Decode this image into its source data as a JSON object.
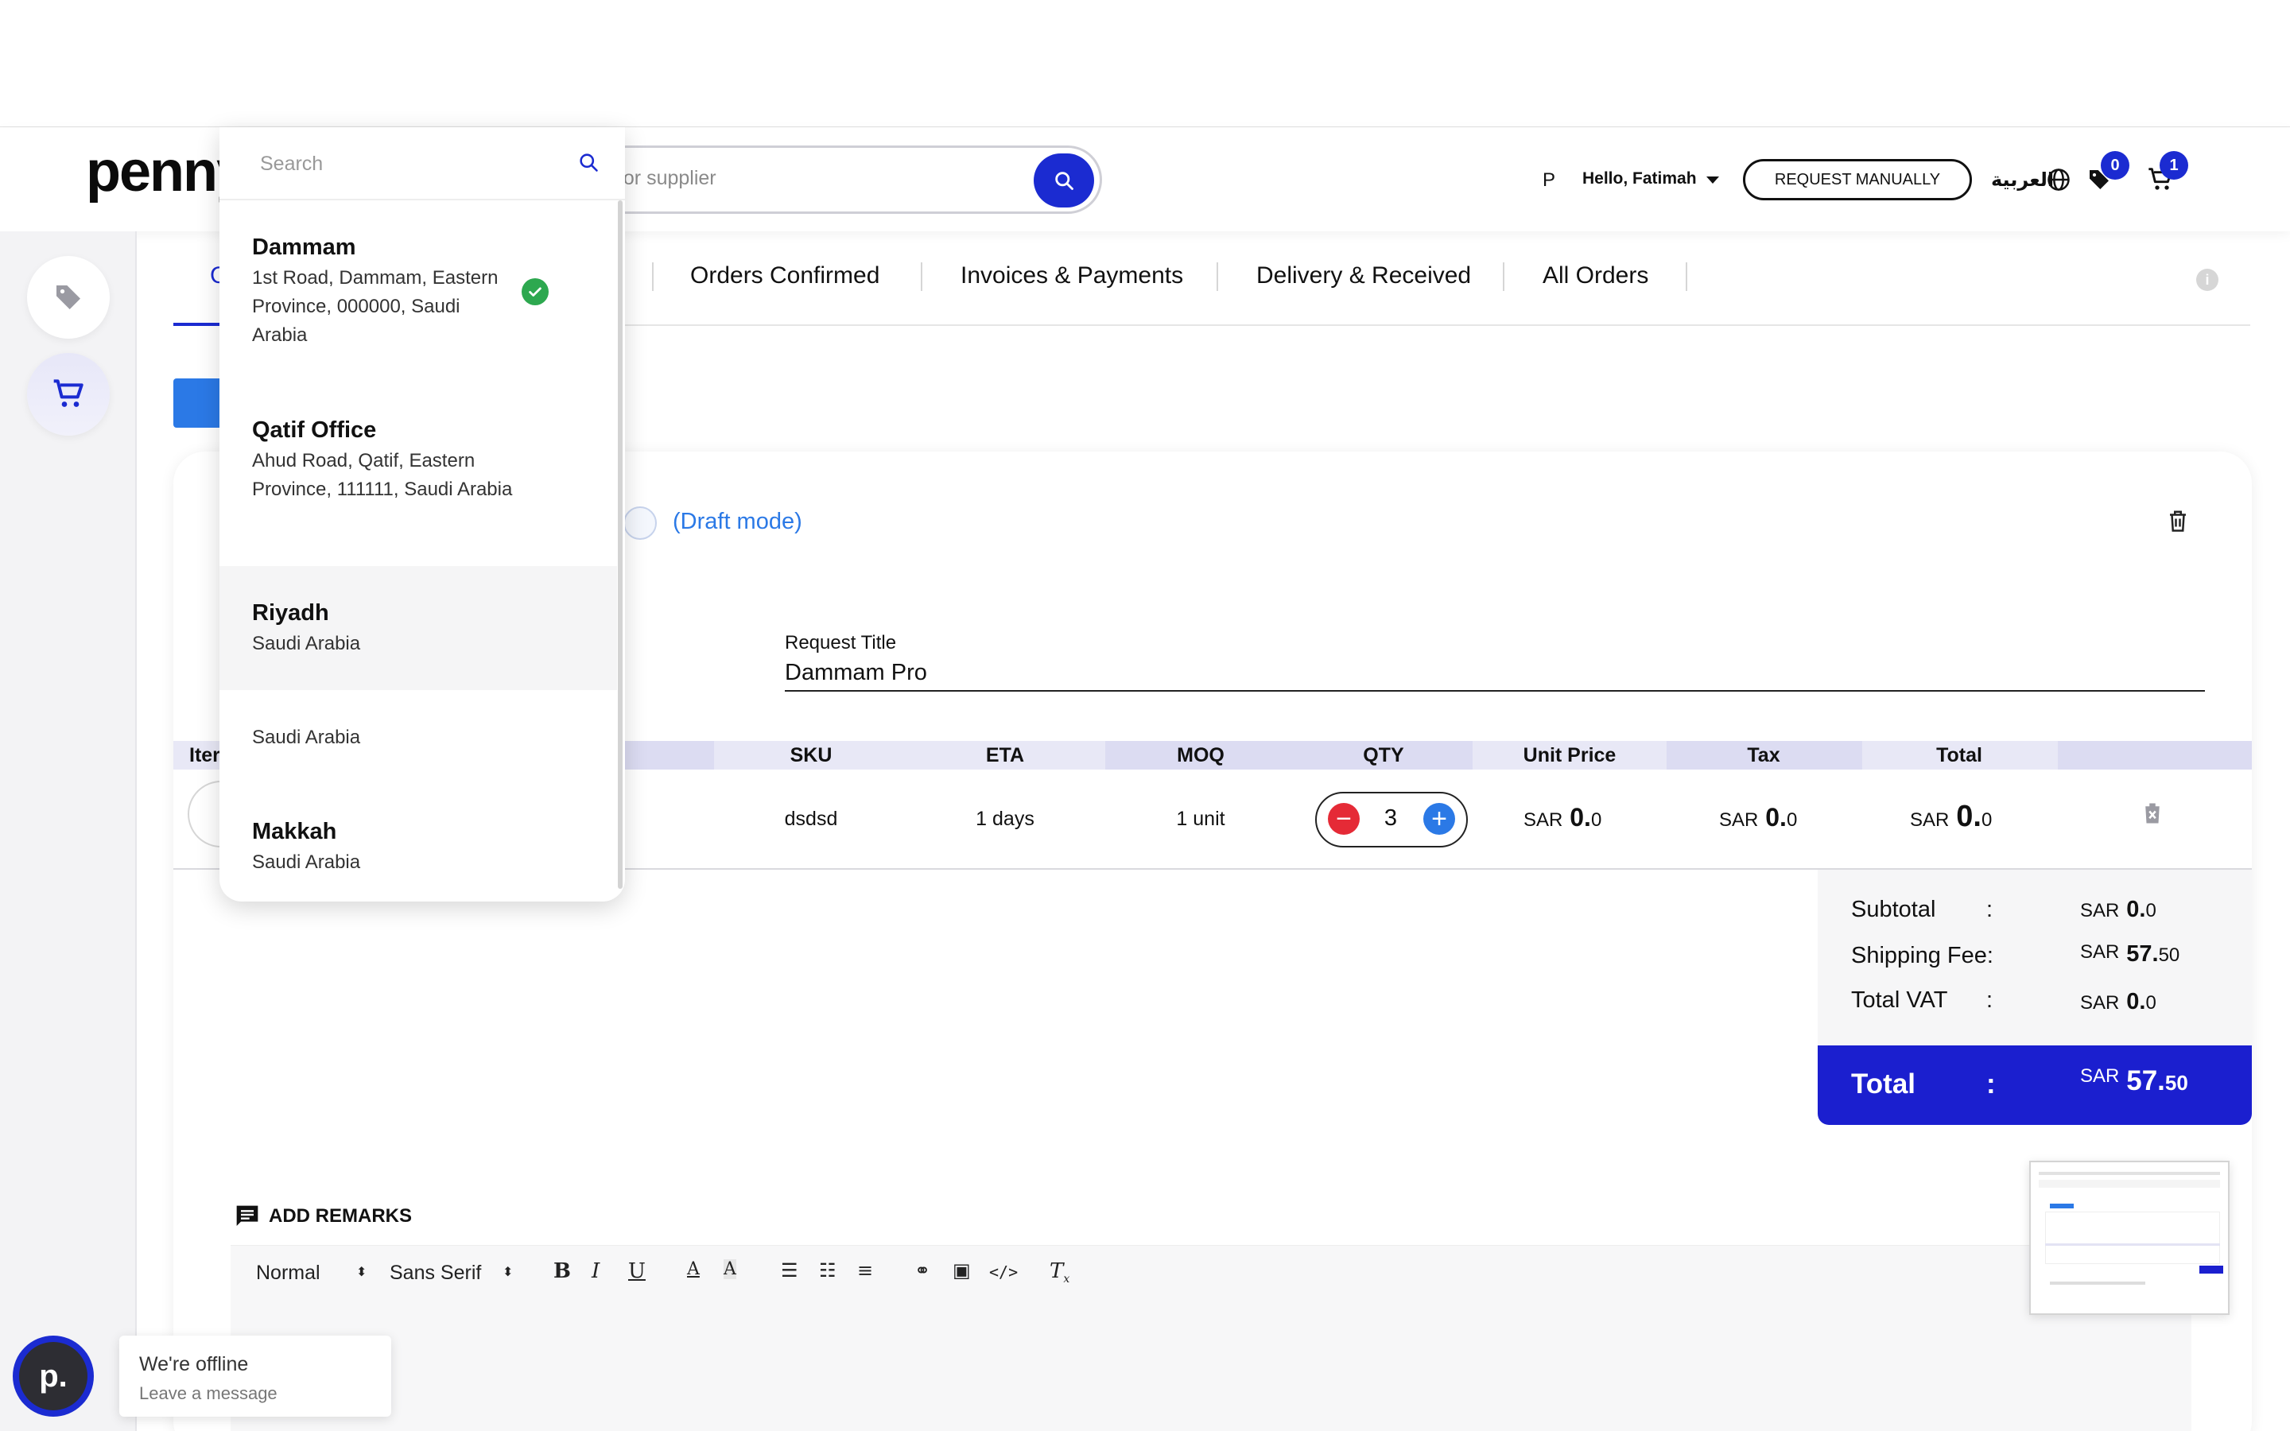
{
  "header": {
    "logo": "penny",
    "search_placeholder": "t or supplier",
    "user_initial": "P",
    "greeting": "Hello, Fatimah",
    "request_manually": "REQUEST MANUALLY",
    "language": "العربية",
    "wishlist_count": "0",
    "cart_count": "1",
    "accent_color": "#1b2bd1"
  },
  "rail": {
    "items": [
      {
        "icon": "tag-icon"
      },
      {
        "icon": "cart-icon",
        "active": true
      }
    ]
  },
  "tabs": {
    "first_partial": "C",
    "items": [
      "Orders Confirmed",
      "Invoices & Payments",
      "Delivery & Received",
      "All Orders"
    ]
  },
  "order": {
    "draft_label": "(Draft mode)",
    "request_title_label": "Request Title",
    "request_title_value": "Dammam Pro",
    "columns": {
      "item": "Iter",
      "sku": "SKU",
      "eta": "ETA",
      "moq": "MOQ",
      "qty": "QTY",
      "unit_price": "Unit Price",
      "tax": "Tax",
      "total": "Total"
    },
    "row": {
      "sku": "dsdsd",
      "eta": "1 days",
      "moq": "1 unit",
      "qty": "3",
      "unit_price": {
        "currency": "SAR",
        "whole": "0.",
        "fraction": "0"
      },
      "tax": {
        "currency": "SAR",
        "whole": "0.",
        "fraction": "0"
      },
      "total": {
        "currency": "SAR",
        "whole": "0.",
        "fraction": "0"
      }
    },
    "summary": {
      "colon": ":",
      "subtotal_label": "Subtotal",
      "subtotal": {
        "currency": "SAR",
        "whole": "0.",
        "fraction": "0"
      },
      "shipping_label": "Shipping Fee:",
      "shipping": {
        "currency": "SAR",
        "whole": "57.",
        "fraction": "50"
      },
      "vat_label": "Total VAT",
      "vat": {
        "currency": "SAR",
        "whole": "0.",
        "fraction": "0"
      },
      "total_label": "Total",
      "total": {
        "currency": "SAR",
        "whole": "57.",
        "fraction": "50"
      }
    }
  },
  "remarks": {
    "title": "ADD REMARKS",
    "toolbar": {
      "style": "Normal",
      "font": "Sans Serif"
    }
  },
  "chat": {
    "avatar_letter": "p.",
    "status": "We're offline",
    "action": "Leave a message"
  },
  "dropdown": {
    "search_placeholder": "Search",
    "locations": [
      {
        "name": "Dammam",
        "address": "1st Road, Dammam, Eastern Province, 000000, Saudi Arabia",
        "selected": true
      },
      {
        "name": "Qatif Office",
        "address": "Ahud Road, Qatif, Eastern Province, 111111, Saudi Arabia"
      },
      {
        "name": "Riyadh",
        "address": "Saudi Arabia"
      },
      {
        "name": "",
        "address": "Saudi Arabia"
      },
      {
        "name": "Makkah",
        "address": "Saudi Arabia"
      }
    ]
  }
}
